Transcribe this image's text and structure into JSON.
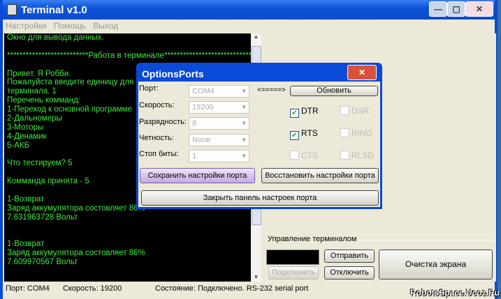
{
  "window": {
    "title": "Terminal v1.0",
    "minimize": "—",
    "maximize": "▢",
    "close": "✕"
  },
  "menu": [
    "Настройки",
    "Помощь",
    "Выход"
  ],
  "terminal_lines": [
    "Окно для вывода данных.",
    "",
    "**************************Работа в терминале*************************************",
    "",
    "Привет. Я Робби.",
    "Пожалуйста введите единицу для по",
    "терминала. 1",
    "Перечень комманд:",
    "1-Переход к основной программе",
    "2-Дальномеры",
    "3-Моторы",
    "4-Динамик",
    "5-АКБ",
    "",
    "Что тестируем? 5",
    "",
    "Комманда принята - 5",
    "",
    "1-Возврат",
    "Заряд аккумулятора состовляет 86%",
    "7.631963728 Вольт",
    "",
    "",
    "1-Возврат",
    "Заряд аккумулятора состовляет 86%",
    "7.609970567 Вольт"
  ],
  "control": {
    "group_label": "Управление терминалом",
    "input_value": "",
    "send": "Отправить",
    "connect": "Подключить",
    "disconnect": "Отключить",
    "clear": "Очистка экрана"
  },
  "status": {
    "port": "Порт: COM4",
    "speed": "Скорость: 19200",
    "state": "Состояние: Подключено. RS-232 serial port"
  },
  "watermark": "RobotsSpace.Ucoz.Ru",
  "dialog": {
    "title": "OptionsPorts",
    "close": "✕",
    "fields": [
      {
        "label": "Порт:",
        "value": "COM4"
      },
      {
        "label": "Скорость:",
        "value": "19200"
      },
      {
        "label": "Разрядность:",
        "value": "8"
      },
      {
        "label": "Четность:",
        "value": "None"
      },
      {
        "label": "Стоп биты:",
        "value": "1"
      }
    ],
    "arrow": "<=====>",
    "refresh": "Обновить",
    "checkboxes": [
      {
        "label": "DTR",
        "checked": true,
        "enabled": true
      },
      {
        "label": "DSR",
        "checked": false,
        "enabled": false
      },
      {
        "label": "RTS",
        "checked": true,
        "enabled": true
      },
      {
        "label": "RING",
        "checked": false,
        "enabled": false
      },
      {
        "label": "CTS",
        "checked": false,
        "enabled": false
      },
      {
        "label": "RLSD",
        "checked": false,
        "enabled": false
      }
    ],
    "save": "Сохранить настройки порта",
    "restore": "Восстановить настройки порта",
    "close_panel": "Закрыть панель настроек порта"
  }
}
